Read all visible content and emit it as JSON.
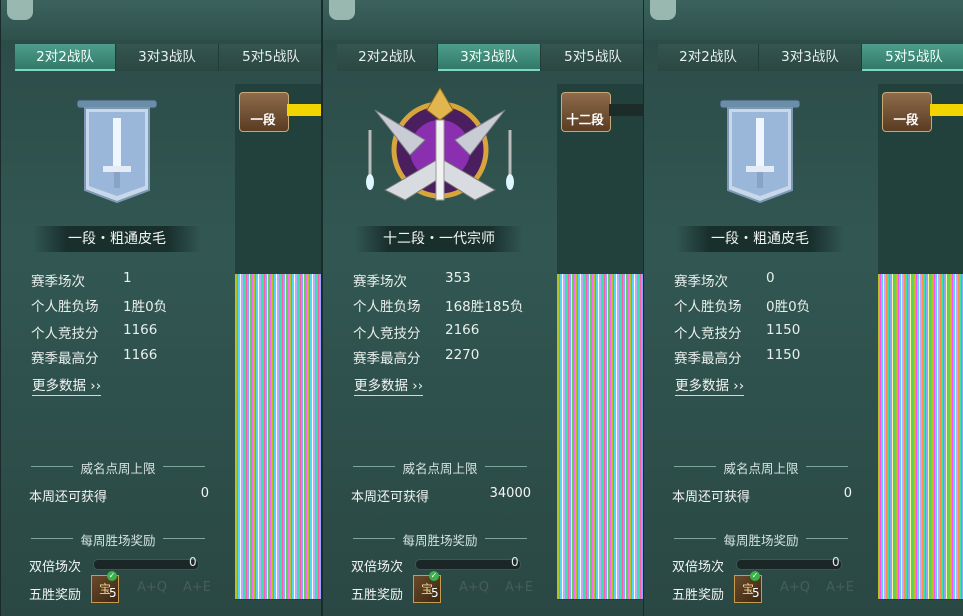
{
  "tabs": [
    "2对2战队",
    "3对3战队",
    "5对5战队"
  ],
  "panels": [
    {
      "active_tab": 0,
      "emblem": "banner-sword-icon",
      "rank_name": "一段・粗通皮毛",
      "stats": [
        {
          "label": "赛季场次",
          "value": "1"
        },
        {
          "label": "个人胜负场",
          "value": "1胜0负"
        },
        {
          "label": "个人竞技分",
          "value": "1166"
        },
        {
          "label": "赛季最高分",
          "value": "1166"
        }
      ],
      "more_data": "更多数据",
      "weekly_cap_title": "威名点周上限",
      "weekly_remaining_label": "本周还可获得",
      "weekly_remaining_value": "0",
      "weekly_win_title": "每周胜场奖励",
      "double_label": "双倍场次",
      "double_value": "0",
      "five_win_label": "五胜奖励",
      "five_win_count": "5",
      "chest_label": "一段"
    },
    {
      "active_tab": 1,
      "emblem": "golden-crest-icon",
      "rank_name": "十二段・一代宗师",
      "stats": [
        {
          "label": "赛季场次",
          "value": "353"
        },
        {
          "label": "个人胜负场",
          "value": "168胜185负"
        },
        {
          "label": "个人竞技分",
          "value": "2166"
        },
        {
          "label": "赛季最高分",
          "value": "2270"
        }
      ],
      "more_data": "更多数据",
      "weekly_cap_title": "威名点周上限",
      "weekly_remaining_label": "本周还可获得",
      "weekly_remaining_value": "34000",
      "weekly_win_title": "每周胜场奖励",
      "double_label": "双倍场次",
      "double_value": "0",
      "five_win_label": "五胜奖励",
      "five_win_count": "5",
      "chest_label": "十二段"
    },
    {
      "active_tab": 2,
      "emblem": "banner-sword-icon",
      "rank_name": "一段・粗通皮毛",
      "stats": [
        {
          "label": "赛季场次",
          "value": "0"
        },
        {
          "label": "个人胜负场",
          "value": "0胜0负"
        },
        {
          "label": "个人竞技分",
          "value": "1150"
        },
        {
          "label": "赛季最高分",
          "value": "1150"
        }
      ],
      "more_data": "更多数据",
      "weekly_cap_title": "威名点周上限",
      "weekly_remaining_label": "本周还可获得",
      "weekly_remaining_value": "0",
      "weekly_win_title": "每周胜场奖励",
      "double_label": "双倍场次",
      "double_value": "0",
      "five_win_label": "五胜奖励",
      "five_win_count": "5",
      "chest_label": "一段"
    }
  ],
  "hotkeys": [
    "A+Q",
    "A+E"
  ],
  "colors": {
    "panel_bg": "#325752",
    "active_tab": "#4f9d8c",
    "progress_fill": "#f2d400"
  }
}
